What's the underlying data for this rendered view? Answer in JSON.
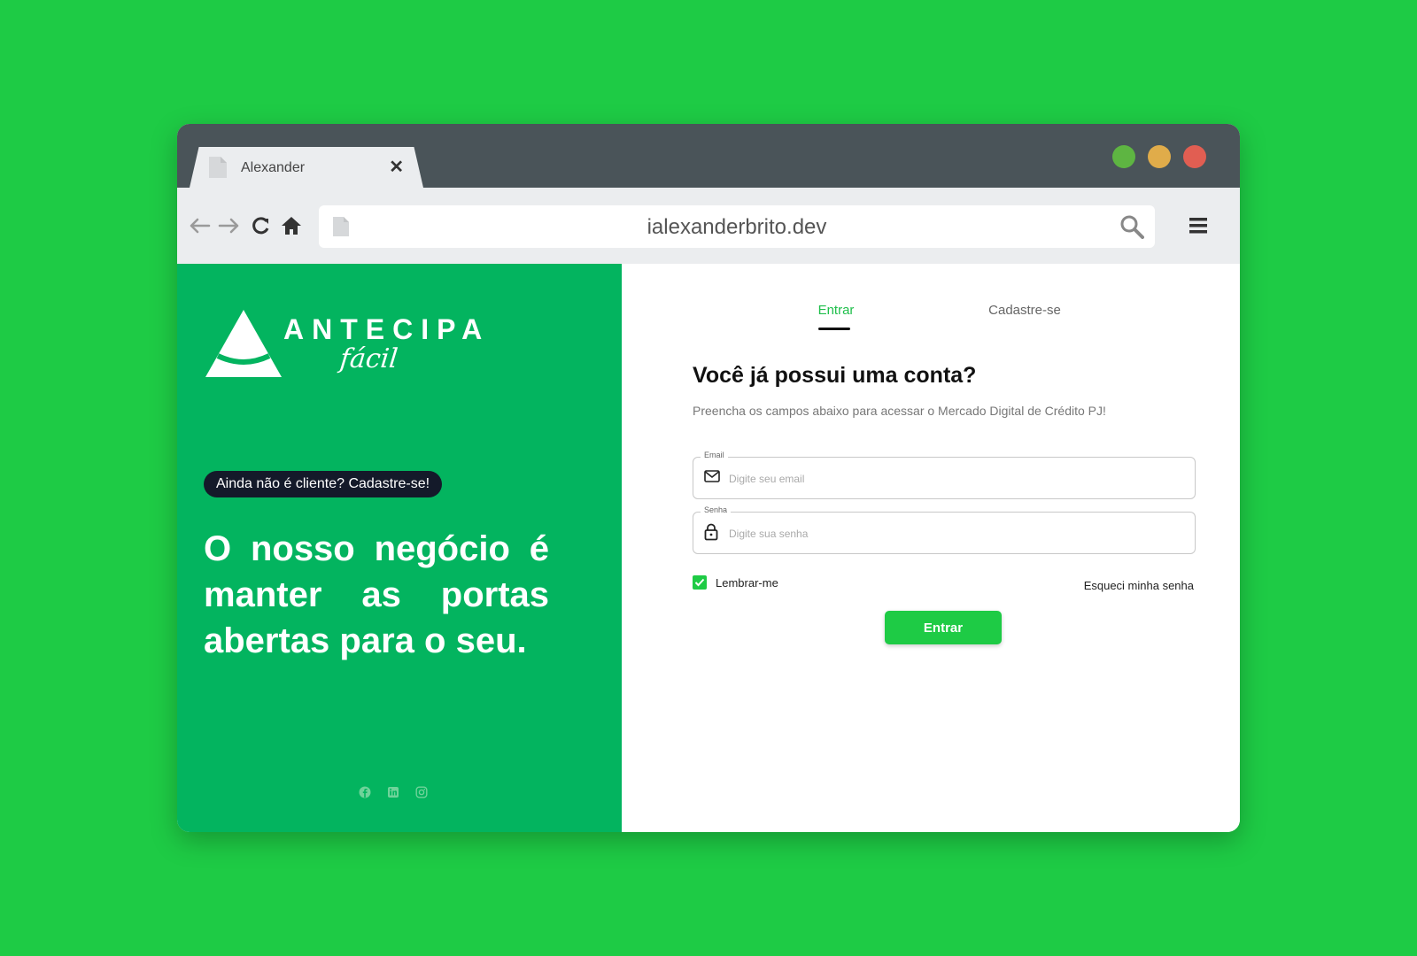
{
  "browser": {
    "tab_title": "Alexander",
    "tab_close": "✕",
    "url": "ialexanderbrito.dev"
  },
  "brand": {
    "name": "ANTECIPA",
    "sub": "fácil"
  },
  "left": {
    "cta_pill": "Ainda não é cliente? Cadastre-se!",
    "headline": "O nosso negócio é manter as portas abertas para o seu."
  },
  "login": {
    "tab_enter": "Entrar",
    "tab_signup": "Cadastre-se",
    "title": "Você já possui uma conta?",
    "subtitle": "Preencha os campos abaixo para acessar o Mercado Digital de Crédito PJ!",
    "email_label": "Email",
    "email_placeholder": "Digite seu email",
    "password_label": "Senha",
    "password_placeholder": "Digite sua senha",
    "remember_label": "Lembrar-me",
    "remember_checked": true,
    "forgot_label": "Esqueci minha senha",
    "submit_label": "Entrar"
  },
  "colors": {
    "background": "#1ecb45",
    "panel_green": "#03b45f",
    "accent": "#1ecb45",
    "titlebar": "#4a5459"
  },
  "icons": [
    "document-icon",
    "back-arrow-icon",
    "forward-arrow-icon",
    "reload-icon",
    "home-icon",
    "search-icon",
    "hamburger-menu-icon",
    "mail-icon",
    "lock-icon",
    "check-icon",
    "facebook-icon",
    "linkedin-icon",
    "instagram-icon"
  ]
}
